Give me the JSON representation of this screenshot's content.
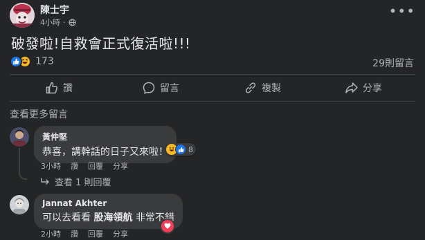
{
  "post": {
    "author": "陳士宇",
    "time": "4小時",
    "text": "破發啦!自救會正式復活啦!!!",
    "reaction_count": "173",
    "comment_count": "29則留言",
    "actions": {
      "like": "讚",
      "comment": "留言",
      "copy": "複製",
      "share": "分享"
    }
  },
  "comments_section": {
    "view_more": "查看更多留言",
    "comments": [
      {
        "name": "黃仲堅",
        "text": "恭喜，講幹話的日子又來啦！",
        "reaction_count": "8",
        "time": "3小時",
        "like_label": "讚",
        "reply_label": "回覆",
        "share_label": "分享",
        "replies_label": "查看 1 則回覆"
      },
      {
        "name": "Jannat Akhter",
        "text_before": "可以去看看",
        "text_bold": "股海領航",
        "text_after": "非常不錯",
        "time": "2小時",
        "like_label": "讚",
        "reply_label": "回覆",
        "share_label": "分享"
      }
    ]
  },
  "colors": {
    "background": "#242526",
    "bubble": "#3a3b3c",
    "text_primary": "#e4e6eb",
    "text_secondary": "#b0b3b8",
    "like_blue": "#1b74e4",
    "haha_yellow": "#f7b928",
    "love_red": "#f33e58"
  },
  "icons": [
    "globe-icon",
    "more-options-icon",
    "like-reaction-icon",
    "haha-reaction-icon",
    "thumbs-up-icon",
    "comment-icon",
    "copy-link-icon",
    "share-icon",
    "reply-arrow-icon",
    "love-reaction-icon"
  ]
}
